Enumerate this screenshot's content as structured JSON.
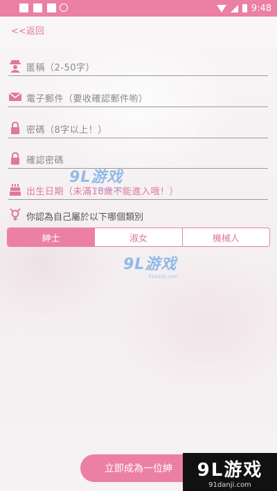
{
  "status_bar": {
    "time": "9:48",
    "background": "#eb7fa4"
  },
  "nav": {
    "back_label": "<<返回"
  },
  "form": {
    "nickname_placeholder": "匿稱（2-50字）",
    "email_placeholder": "電子郵件（要收確認郵件喲）",
    "password_placeholder": "密碼（8字以上！）",
    "confirm_password_placeholder": "確認密碼",
    "birthday_placeholder": "出生日期（未滿18歲不能進入哦！）",
    "gender_question": "你認為自己屬於以下哪個類別",
    "gender_options": [
      "紳士",
      "淑女",
      "機械人"
    ],
    "gender_selected": "紳士",
    "submit_label": "立即成為一位紳"
  },
  "watermark": {
    "brand": "9L游戏",
    "site": "91danji.com"
  },
  "icons": {
    "nickname": "person-hat-icon",
    "email": "envelope-icon",
    "password": "lock-icon",
    "confirm_password": "lock-icon",
    "birthday": "cake-icon",
    "gender": "gender-symbol-icon",
    "wifi": "wifi-icon",
    "signal": "signal-icon",
    "battery": "battery-icon"
  },
  "colors": {
    "accent": "#eb7fa4",
    "accent_text": "#e0789e",
    "placeholder": "#8a8a8a"
  }
}
